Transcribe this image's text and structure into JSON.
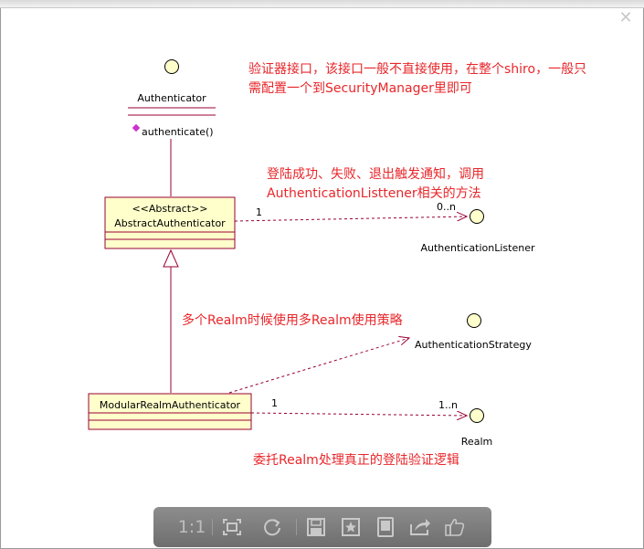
{
  "diagram": {
    "classes": {
      "authenticator": {
        "name": "Authenticator",
        "operation": "authenticate()"
      },
      "abstract_authenticator": {
        "stereotype": "<<Abstract>>",
        "name": "AbstractAuthenticator"
      },
      "modular": {
        "name": "ModularRealmAuthenticator"
      }
    },
    "interfaces": {
      "listener": "AuthenticationListener",
      "strategy": "AuthenticationStrategy",
      "realm": "Realm"
    },
    "multiplicities": {
      "listener_source": "1",
      "listener_target": "0..n",
      "realm_source": "1",
      "realm_target": "1..n"
    },
    "notes": {
      "authenticator_line1": "验证器接口，该接口一般不直接使用，在整个shiro，一般只",
      "authenticator_line2": "需配置一个到SecurityManager里即可",
      "listener_line1": "登陆成功、失败、退出触发通知，调用",
      "listener_line2": "AuthenticationListtener相关的方法",
      "strategy": "多个Realm时候使用多Realm使用策略",
      "realm": "委托Realm处理真正的登陆验证逻辑"
    }
  },
  "viewer": {
    "close_label": "✕",
    "zoom_label": "1:1",
    "tools": [
      "actual-size",
      "fit-screen",
      "rotate",
      "save",
      "favorite",
      "tablet",
      "share",
      "like"
    ]
  },
  "colors": {
    "class_fill": "#ffffcc",
    "class_border": "#990033",
    "note": "#e8262a",
    "toolbar": "#7a7a7a"
  }
}
